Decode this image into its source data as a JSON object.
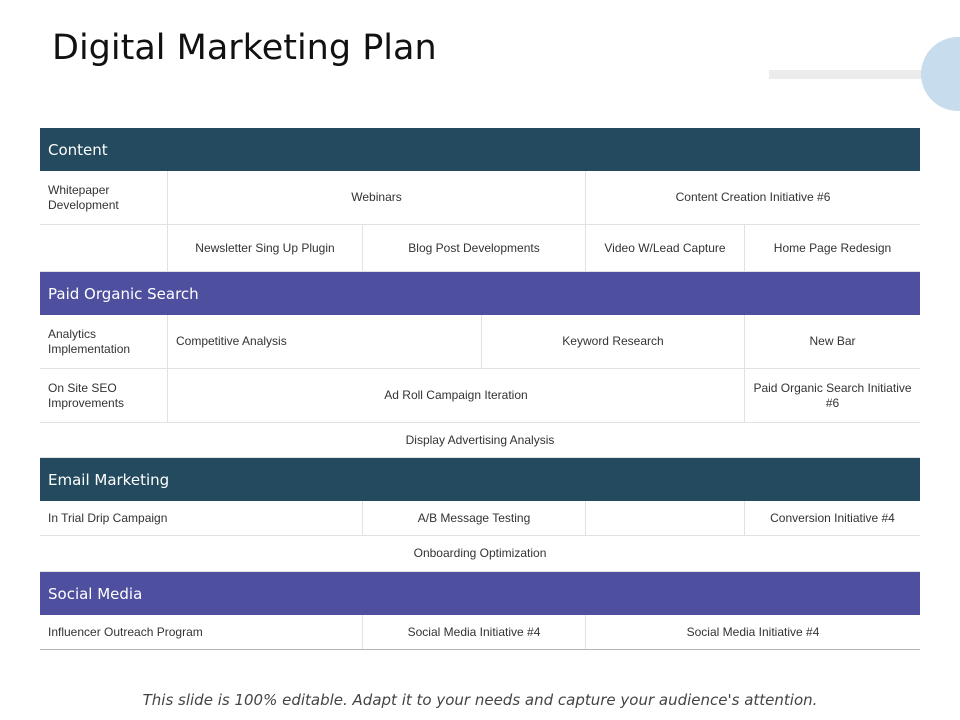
{
  "title": "Digital Marketing Plan",
  "footer": "This slide is 100% editable. Adapt it to your needs and capture your audience's attention.",
  "colors": {
    "section_dark": "#234a5e",
    "section_purple": "#4f4f9f",
    "accent_circle": "#c7dced"
  },
  "content": {
    "header": "Content",
    "row1": {
      "c1": "Whitepaper Development",
      "c2": "Webinars",
      "c3": "Content Creation Initiative #6"
    },
    "row2": {
      "c1": "",
      "c2": "Newsletter Sing Up Plugin",
      "c3": "Blog Post Developments",
      "c4": "Video W/Lead Capture",
      "c5": "Home Page Redesign"
    }
  },
  "paid": {
    "header": "Paid Organic Search",
    "row1": {
      "c1": "Analytics Implementation",
      "c2": "Competitive  Analysis",
      "c3": "Keyword Research",
      "c4": "New Bar"
    },
    "row2": {
      "c1": "On Site SEO Improvements",
      "c2": "Ad Roll Campaign  Iteration",
      "c3": "Paid Organic Search Initiative #6"
    },
    "row3": {
      "c1": "Display Advertising  Analysis"
    }
  },
  "email": {
    "header": "Email Marketing",
    "row1": {
      "c1": "In Trial Drip Campaign",
      "c2": "A/B Message Testing",
      "c3": "",
      "c4": "Conversion  Initiative #4"
    },
    "row2": {
      "c1": "Onboarding  Optimization"
    }
  },
  "social": {
    "header": "Social Media",
    "row1": {
      "c1": "Influencer  Outreach Program",
      "c2": "Social Media Initiative #4",
      "c3": "Social Media Initiative #4"
    }
  }
}
